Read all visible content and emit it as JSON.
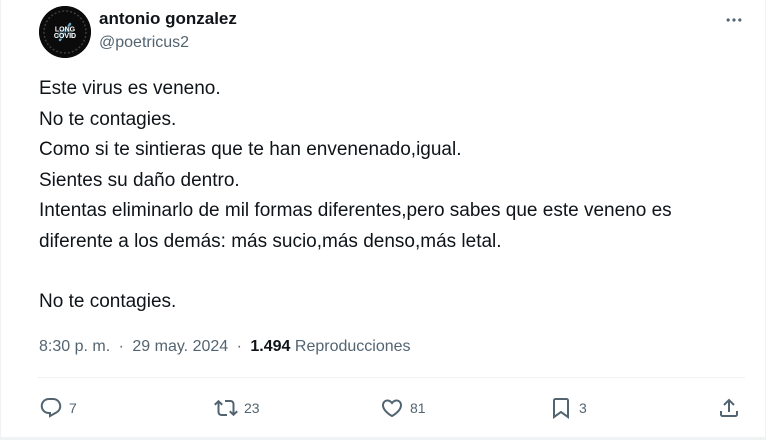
{
  "author": {
    "display_name": "antonio gonzalez",
    "handle": "@poetricus2",
    "avatar_text": {
      "line1": "LONG",
      "line2": "COVID"
    }
  },
  "tweet": {
    "lines": [
      "Este virus es veneno.",
      "No te contagies.",
      "Como si te sintieras que te han envenenado,igual.",
      "Sientes su daño dentro.",
      "Intentas eliminarlo de mil formas diferentes,pero sabes que este veneno es",
      "diferente a los demás: más sucio,más denso,más letal."
    ],
    "closing_line": "No te contagies."
  },
  "meta": {
    "time": "8:30 p. m.",
    "separator": "·",
    "date": "29 may. 2024",
    "views_count": "1.494",
    "views_label": "Reproducciones"
  },
  "actions": {
    "reply_count": "7",
    "retweet_count": "23",
    "like_count": "81",
    "bookmark_count": "3"
  },
  "icons": {
    "more": "more-icon",
    "reply": "reply-icon",
    "retweet": "retweet-icon",
    "like": "heart-icon",
    "bookmark": "bookmark-icon",
    "share": "share-icon"
  },
  "colors": {
    "text_primary": "#0f1419",
    "text_secondary": "#536471",
    "divider": "#eff3f4",
    "avatar_bg": "#0b0b0b",
    "avatar_accent": "#5ea7c2"
  }
}
